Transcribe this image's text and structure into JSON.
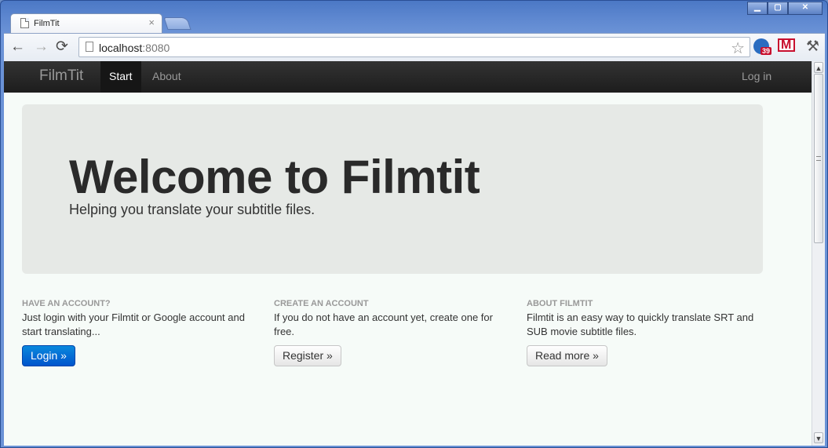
{
  "browser": {
    "tab_title": "FilmTit",
    "tab_close": "×",
    "url_host": "localhost",
    "url_port": ":8080",
    "extension_badge_count": "39",
    "window_controls": {
      "minimize": "▁",
      "maximize": "▢",
      "close": "✕"
    },
    "nav": {
      "back": "←",
      "forward": "→",
      "reload": "⟳"
    },
    "star": "☆",
    "wrench": "🔧"
  },
  "navbar": {
    "brand": "FilmTit",
    "links": [
      {
        "label": "Start",
        "active": true
      },
      {
        "label": "About",
        "active": false
      }
    ],
    "login": "Log in"
  },
  "hero": {
    "title": "Welcome to Filmtit",
    "subtitle": "Helping you translate your subtitle files."
  },
  "columns": [
    {
      "heading": "HAVE AN ACCOUNT?",
      "text": "Just login with your Filmtit or Google account and start translating...",
      "button": "Login »"
    },
    {
      "heading": "CREATE AN ACCOUNT",
      "text": "If you do not have an account yet, create one for free.",
      "button": "Register »"
    },
    {
      "heading": "ABOUT FILMTIT",
      "text": "Filmtit is an easy way to quickly translate SRT and SUB movie subtitle files.",
      "button": "Read more »"
    }
  ],
  "colors": {
    "navbar_bg": "#1d1d1d",
    "hero_bg": "#e6e9e6",
    "primary_button": "#0055cc",
    "page_bg": "#f6fbf8"
  }
}
